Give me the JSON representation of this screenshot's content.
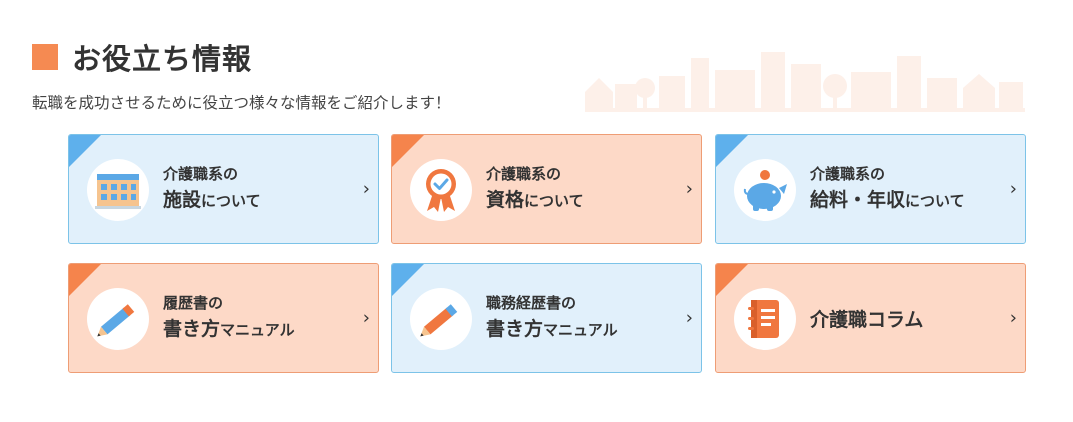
{
  "header": {
    "title": "お役立ち情報",
    "subtitle": "転職を成功させるために役立つ様々な情報をご紹介します！"
  },
  "colors": {
    "accent": "#f58a52",
    "blue_card": "#e1f0fb",
    "orange_card": "#fdd9c7"
  },
  "cards": [
    {
      "line1": "介護職系の",
      "line2_main": "施設",
      "line2_small": "について",
      "icon": "building-icon",
      "theme": "blue"
    },
    {
      "line1": "介護職系の",
      "line2_main": "資格",
      "line2_small": "について",
      "icon": "award-badge-icon",
      "theme": "orange"
    },
    {
      "line1": "介護職系の",
      "line2_main": "給料・年収",
      "line2_small": "について",
      "icon": "piggy-bank-icon",
      "theme": "blue"
    },
    {
      "line1": "履歴書の",
      "line2_main": "書き方",
      "line2_small": "マニュアル",
      "icon": "pencil-icon",
      "theme": "orange"
    },
    {
      "line1": "職務経歴書の",
      "line2_main": "書き方",
      "line2_small": "マニュアル",
      "icon": "pencil-icon",
      "theme": "blue"
    },
    {
      "single": "介護職コラム",
      "icon": "notebook-icon",
      "theme": "orange"
    }
  ],
  "chevron": "›"
}
